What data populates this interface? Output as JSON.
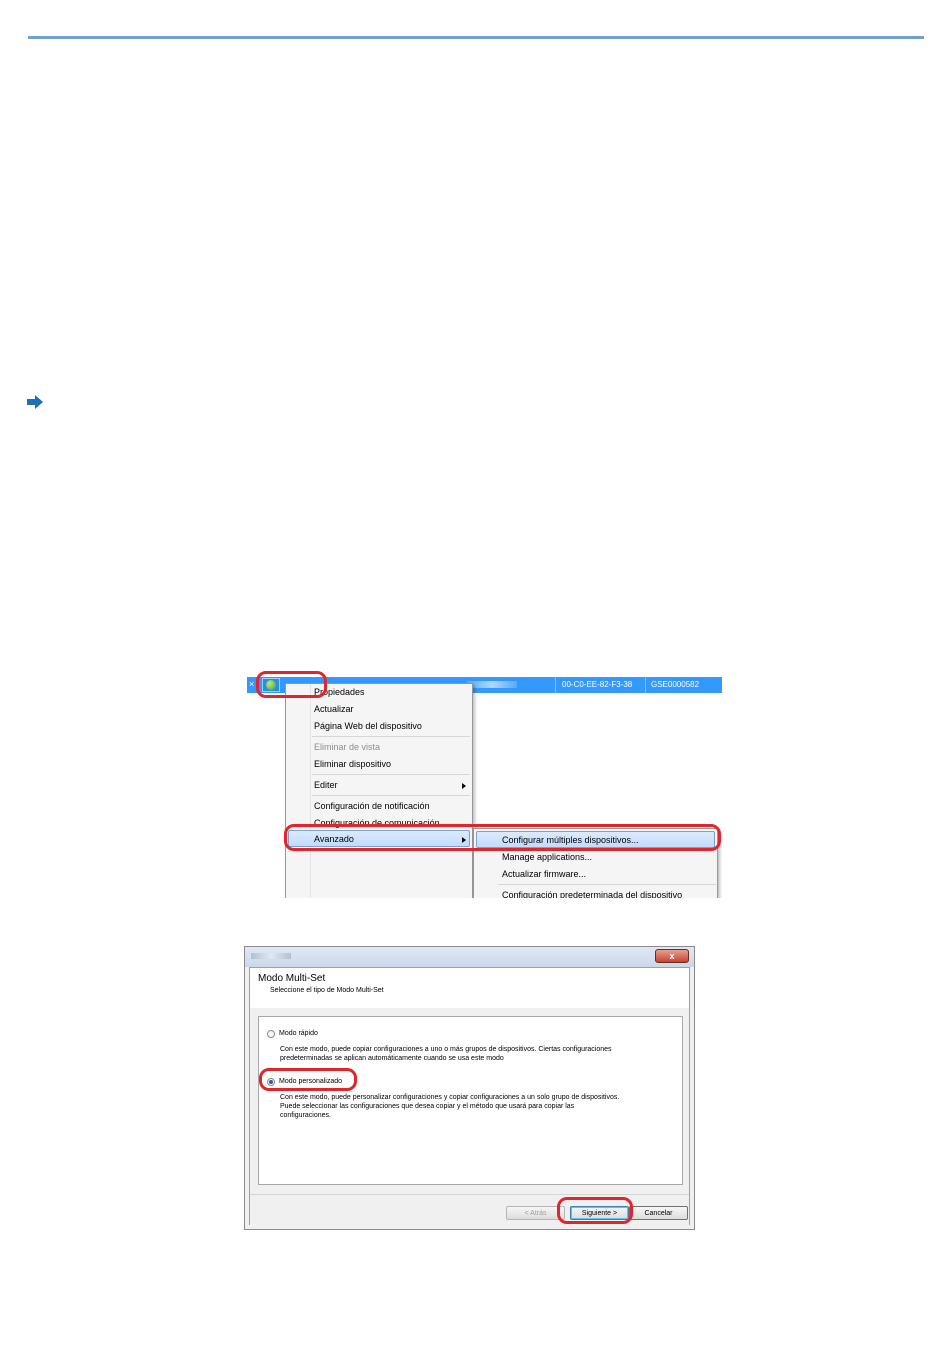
{
  "device_row": {
    "mac": "00-C0-EE-82-F3-38",
    "serial": "GSE0000582"
  },
  "context_menu": {
    "items": [
      "Propiedades",
      "Actualizar",
      "Página Web del dispositivo",
      "Eliminar de vista",
      "Eliminar dispositivo",
      "Editer",
      "Configuración de notificación",
      "Configuración de comunicación",
      "Avanzado"
    ]
  },
  "submenu": {
    "items": [
      "Configurar múltiples dispositivos...",
      "Manage applications...",
      "Actualizar firmware...",
      "Configuración predeterminada del dispositivo"
    ]
  },
  "dialog": {
    "close": "x",
    "title": "Modo Multi-Set",
    "subtitle": "Seleccione el tipo de Modo Multi-Set",
    "option_quick": {
      "label": "Modo rápido",
      "desc": [
        "Con este modo, puede copiar configuraciones a uno o más grupos de dispositivos. Ciertas configuraciones",
        "predeterminadas se aplican automáticamente cuando se usa este modo"
      ]
    },
    "option_custom": {
      "label": "Modo personalizado",
      "desc": [
        "Con este modo, puede personalizar configuraciones y copiar configuraciones a un solo grupo de dispositivos.",
        "Puede seleccionar las configuraciones que desea copiar y el método que usará para copiar las",
        "configuraciones."
      ]
    },
    "buttons": {
      "back": "< Atrás",
      "next": "Siguiente >",
      "cancel": "Cancelar"
    }
  },
  "colors": {
    "rule": "#6fa0d0",
    "selection": "#3399ff",
    "callout": "#e0262b",
    "arrow": "#1f6fb6"
  }
}
